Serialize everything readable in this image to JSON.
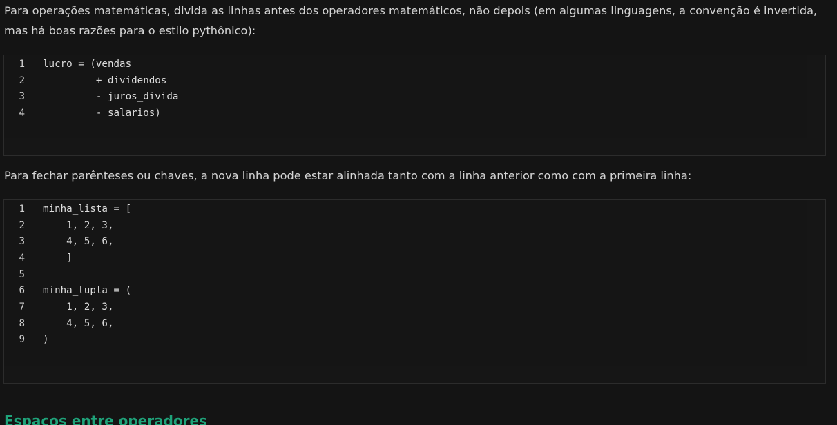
{
  "paragraphs": {
    "p1": "Para operações matemáticas, divida as linhas antes dos operadores matemáticos, não depois (em algumas linguagens, a convenção é invertida, mas há boas razões para o estilo pythônico):",
    "p2": "Para fechar parênteses ou chaves, a nova linha pode estar alinhada tanto com a linha anterior como com a primeira linha:"
  },
  "code_blocks": [
    {
      "lines": [
        {
          "num": "1",
          "code": "lucro = (vendas"
        },
        {
          "num": "2",
          "code": "         + dividendos"
        },
        {
          "num": "3",
          "code": "         - juros_divida"
        },
        {
          "num": "4",
          "code": "         - salarios)"
        }
      ]
    },
    {
      "lines": [
        {
          "num": "1",
          "code": "minha_lista = ["
        },
        {
          "num": "2",
          "code": "    1, 2, 3,"
        },
        {
          "num": "3",
          "code": "    4, 5, 6,"
        },
        {
          "num": "4",
          "code": "    ]"
        },
        {
          "num": "5",
          "code": ""
        },
        {
          "num": "6",
          "code": "minha_tupla = ("
        },
        {
          "num": "7",
          "code": "    1, 2, 3,"
        },
        {
          "num": "8",
          "code": "    4, 5, 6,"
        },
        {
          "num": "9",
          "code": ")"
        }
      ]
    }
  ],
  "section_heading": "Espaços entre operadores",
  "colors": {
    "background": "#141414",
    "heading_accent": "#1fa37a",
    "text": "#d4d4d4"
  }
}
